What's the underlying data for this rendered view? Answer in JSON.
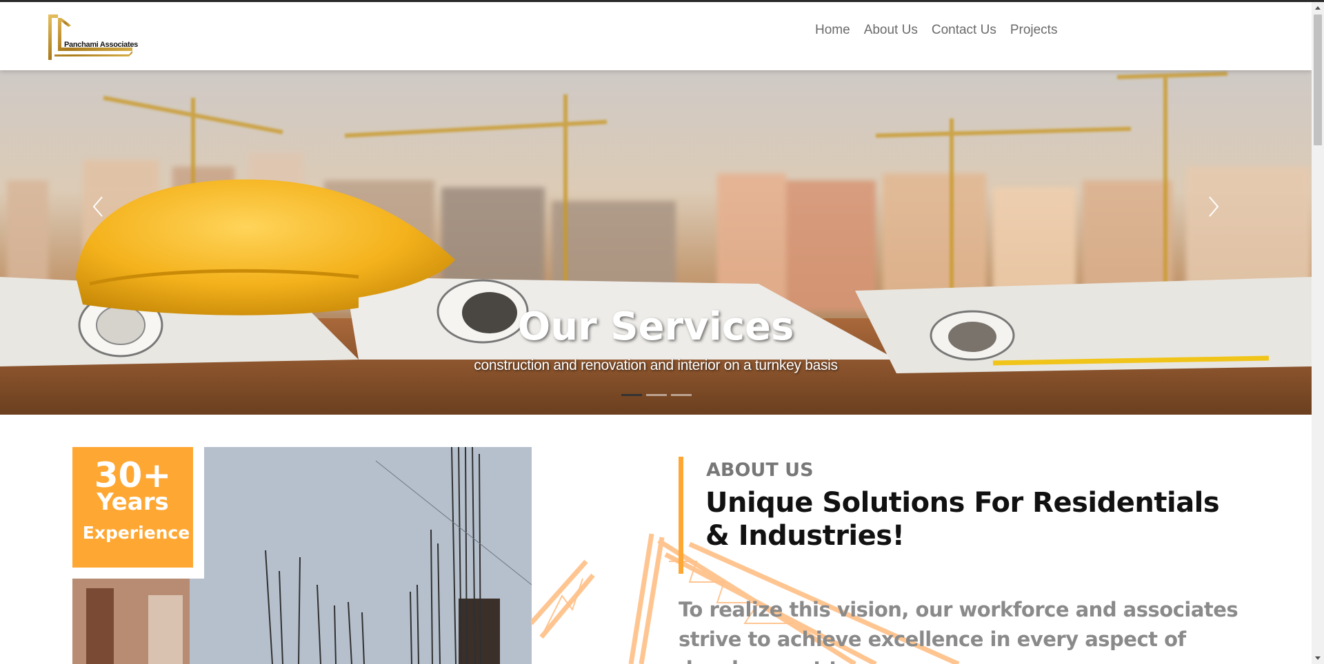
{
  "brand": {
    "name": "Panchami Associates",
    "color": "#c89b2e"
  },
  "nav": [
    {
      "label": "Home"
    },
    {
      "label": "About Us"
    },
    {
      "label": "Contact Us"
    },
    {
      "label": "Projects"
    }
  ],
  "hero": {
    "title": "Our Services",
    "subtitle": "construction and renovation and interior on a turnkey basis",
    "slides": 3,
    "active_slide": 1
  },
  "experience": {
    "number": "30+",
    "years": "Years",
    "label": "Experience"
  },
  "about": {
    "label": "ABOUT US",
    "heading": "Unique Solutions For Residentials & Industries!",
    "text": "To realize this vision, our workforce and associates strive to achieve excellence in every aspect of development to"
  },
  "colors": {
    "accent": "#ffa733",
    "nav_text": "#6a6a6a",
    "heading": "#111111"
  }
}
